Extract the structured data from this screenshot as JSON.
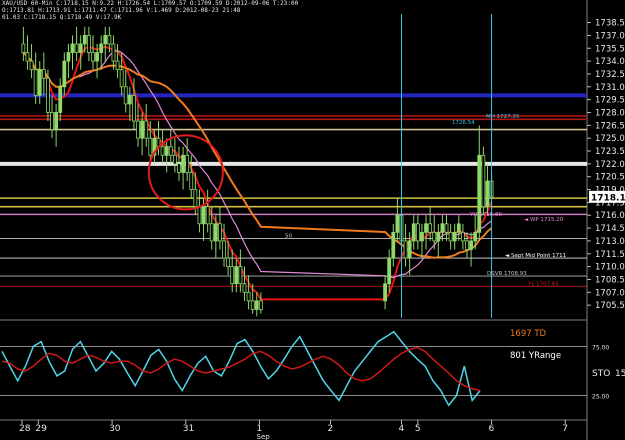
{
  "header": {
    "line1": "XAU/USD 60-Min  C:1718.15  N:9.22  H:1726.54  L:1709.57  O:1709.59  D:2012-09-06  T:23:00",
    "line2": "O:1713.81  H:1713.91  L:1711.47  C:1711.96  V:1.469  D:2012-08-23  21:48",
    "line3": "01.03  C:1718.15  Q:1718.49  V:17.9K"
  },
  "colors": {
    "background": "#000000",
    "candle": "#8fd86a",
    "sma_slow": "#f07a1e",
    "sma_fast": "#e81515",
    "band_upper": "#f0c8f0",
    "band_lower": "#f0e6c8",
    "band_mid": "#e48ad8",
    "yellow_level": "#e8d34a",
    "cyan": "#39c7e8",
    "stoch_fast": "#4fd6e8",
    "stoch_slow": "#d01818",
    "white_level": "#ffffff",
    "blue_level": "#2a2ad8",
    "highlight_circle": "#e01c1c"
  },
  "chart_data": {
    "type": "candlestick",
    "instrument": "XAU/USD",
    "timeframe": "60-Min",
    "price_axis": {
      "ylim": [
        1704.0,
        1739.5
      ],
      "ticks": [
        1738.5,
        1737.0,
        1735.5,
        1734.0,
        1732.5,
        1731.0,
        1729.5,
        1728.0,
        1726.5,
        1725.0,
        1723.5,
        1722.0,
        1720.5,
        1719.0,
        1717.5,
        1716.0,
        1714.5,
        1713.0,
        1711.5,
        1710.0,
        1708.5,
        1707.0,
        1705.5
      ],
      "tick_labels": [
        "1738.50",
        "1737.00",
        "1735.50",
        "1734.00",
        "1732.50",
        "1731.00",
        "1729.50",
        "1728.00",
        "1726.50",
        "1725.00",
        "1723.50",
        "1722.00",
        "1720.50",
        "1719.00",
        "1717.50",
        "1716.00",
        "1714.50",
        "1713.00",
        "1711.50",
        "1710.00",
        "1708.50",
        "1707.00",
        "1705.50"
      ],
      "last_price": 1718.15,
      "last_price_label": "1718.15"
    },
    "x_axis": {
      "labels": [
        {
          "text": "28",
          "day_index": 0
        },
        {
          "text": "29",
          "day_index": 0.6
        },
        {
          "text": "30",
          "day_index": 3.3
        },
        {
          "text": "31",
          "day_index": 6.0
        },
        {
          "text": "1",
          "day_index": 8.7
        },
        {
          "text": "Sep",
          "day_index": 8.7
        },
        {
          "text": "2",
          "day_index": 11.3
        },
        {
          "text": "4",
          "day_index": 13.9
        },
        {
          "text": "5",
          "day_index": 14.5
        },
        {
          "text": "6",
          "day_index": 17.2
        },
        {
          "text": "7",
          "day_index": 19.9
        }
      ]
    },
    "candles": [
      [
        0.05,
        1736,
        1738,
        1734,
        1735
      ],
      [
        0.2,
        1735,
        1737,
        1733,
        1734
      ],
      [
        0.35,
        1734,
        1736,
        1732,
        1733
      ],
      [
        0.5,
        1733,
        1735,
        1729,
        1730
      ],
      [
        0.65,
        1730,
        1734,
        1729,
        1733
      ],
      [
        0.8,
        1733,
        1735,
        1730,
        1732
      ],
      [
        0.95,
        1732,
        1733,
        1727,
        1728
      ],
      [
        1.1,
        1728,
        1730,
        1725,
        1726
      ],
      [
        1.25,
        1726,
        1729,
        1724,
        1728
      ],
      [
        1.4,
        1728,
        1732,
        1727,
        1731
      ],
      [
        1.55,
        1731,
        1735,
        1730,
        1734
      ],
      [
        1.7,
        1734,
        1736,
        1732,
        1735
      ],
      [
        1.85,
        1735,
        1737,
        1733,
        1736
      ],
      [
        2.0,
        1736,
        1738,
        1734,
        1735
      ],
      [
        2.15,
        1735,
        1737,
        1733,
        1736
      ],
      [
        2.3,
        1736,
        1738,
        1735,
        1737
      ],
      [
        2.45,
        1737,
        1738,
        1734,
        1735
      ],
      [
        2.6,
        1735,
        1737,
        1733,
        1734
      ],
      [
        2.75,
        1734,
        1736,
        1732,
        1735
      ],
      [
        2.9,
        1735,
        1737,
        1733,
        1736
      ],
      [
        3.05,
        1736,
        1738,
        1734,
        1737
      ],
      [
        3.2,
        1737,
        1738,
        1735,
        1736
      ],
      [
        3.35,
        1736,
        1737,
        1733,
        1734
      ],
      [
        3.5,
        1734,
        1736,
        1732,
        1733
      ],
      [
        3.65,
        1733,
        1735,
        1730,
        1731
      ],
      [
        3.8,
        1731,
        1733,
        1728,
        1729
      ],
      [
        3.95,
        1729,
        1731,
        1727,
        1730
      ],
      [
        4.1,
        1730,
        1732,
        1726,
        1727
      ],
      [
        4.25,
        1727,
        1729,
        1724,
        1725
      ],
      [
        4.4,
        1725,
        1728,
        1723,
        1727
      ],
      [
        4.55,
        1727,
        1729,
        1724,
        1725
      ],
      [
        4.7,
        1725,
        1727,
        1722,
        1723
      ],
      [
        4.85,
        1723,
        1726,
        1722,
        1725
      ],
      [
        5.0,
        1725,
        1727,
        1723,
        1724
      ],
      [
        5.15,
        1724,
        1726,
        1722,
        1723
      ],
      [
        5.3,
        1723,
        1725,
        1721,
        1724
      ],
      [
        5.45,
        1724,
        1726,
        1722,
        1723
      ],
      [
        5.6,
        1723,
        1725,
        1721,
        1722
      ],
      [
        5.75,
        1722,
        1724,
        1720,
        1721
      ],
      [
        5.9,
        1721,
        1724,
        1719,
        1723
      ],
      [
        6.05,
        1723,
        1725,
        1720,
        1721
      ],
      [
        6.2,
        1721,
        1723,
        1718,
        1719
      ],
      [
        6.35,
        1719,
        1721,
        1716,
        1717
      ],
      [
        6.5,
        1717,
        1719,
        1714,
        1715
      ],
      [
        6.65,
        1715,
        1718,
        1713,
        1717
      ],
      [
        6.8,
        1717,
        1719,
        1714,
        1715
      ],
      [
        6.95,
        1715,
        1717,
        1712,
        1713
      ],
      [
        7.1,
        1713,
        1716,
        1711,
        1715
      ],
      [
        7.25,
        1715,
        1717,
        1712,
        1713
      ],
      [
        7.4,
        1713,
        1715,
        1710,
        1711
      ],
      [
        7.55,
        1711,
        1713,
        1709,
        1710
      ],
      [
        7.7,
        1710,
        1712,
        1707,
        1708
      ],
      [
        7.85,
        1708,
        1711,
        1707,
        1710
      ],
      [
        8.0,
        1710,
        1712,
        1707,
        1708
      ],
      [
        8.15,
        1708,
        1710,
        1706,
        1707
      ],
      [
        8.3,
        1707,
        1709,
        1705,
        1706
      ],
      [
        8.45,
        1706,
        1708,
        1704.5,
        1705
      ],
      [
        8.6,
        1705,
        1707,
        1704.2,
        1706
      ],
      [
        8.75,
        1706,
        1707,
        1704.5,
        1705
      ],
      [
        13.3,
        1706,
        1709,
        1705,
        1708
      ],
      [
        13.45,
        1708,
        1712,
        1707,
        1711
      ],
      [
        13.6,
        1711,
        1715,
        1710,
        1714
      ],
      [
        13.75,
        1714,
        1718,
        1713,
        1716
      ],
      [
        13.9,
        1716,
        1717,
        1712,
        1713
      ],
      [
        14.05,
        1713,
        1715,
        1710,
        1711
      ],
      [
        14.2,
        1711,
        1714,
        1709,
        1713
      ],
      [
        14.35,
        1713,
        1716,
        1712,
        1715
      ],
      [
        14.5,
        1715,
        1716,
        1712,
        1713
      ],
      [
        14.65,
        1713,
        1715,
        1711,
        1714
      ],
      [
        14.8,
        1714,
        1716,
        1712,
        1715
      ],
      [
        14.95,
        1715,
        1717,
        1713,
        1714
      ],
      [
        15.1,
        1714,
        1716,
        1712,
        1713
      ],
      [
        15.25,
        1713,
        1715,
        1711,
        1714
      ],
      [
        15.4,
        1714,
        1716,
        1713,
        1715
      ],
      [
        15.55,
        1715,
        1716,
        1713,
        1714
      ],
      [
        15.7,
        1714,
        1715,
        1712,
        1713
      ],
      [
        15.85,
        1713,
        1715,
        1712,
        1714
      ],
      [
        16.0,
        1714,
        1716,
        1713,
        1715
      ],
      [
        16.15,
        1714,
        1715,
        1712,
        1713
      ],
      [
        16.3,
        1713,
        1714,
        1711,
        1712
      ],
      [
        16.45,
        1712,
        1714,
        1710,
        1713
      ],
      [
        16.6,
        1713,
        1716,
        1712,
        1714
      ],
      [
        16.75,
        1714,
        1726.5,
        1713,
        1723
      ],
      [
        16.9,
        1723,
        1724,
        1716,
        1717
      ],
      [
        17.05,
        1717,
        1722,
        1716,
        1720
      ],
      [
        17.2,
        1720,
        1721,
        1716,
        1718.15
      ]
    ],
    "horizontal_levels": [
      {
        "price": 1722.0,
        "color": "#ffffff",
        "style": "thick"
      },
      {
        "price": 1730.0,
        "color": "#2a2ad8",
        "style": "thick"
      },
      {
        "price": 1727.6,
        "color": "#c51a1a",
        "style": "solid"
      },
      {
        "price": 1727.2,
        "color": "#c51a1a",
        "style": "solid"
      },
      {
        "price": 1726.0,
        "color": "#e8d6a0",
        "style": "solid"
      },
      {
        "price": 1718.0,
        "color": "#e8d34a",
        "style": "solid"
      },
      {
        "price": 1717.0,
        "color": "#e8d34a",
        "style": "solid"
      },
      {
        "price": 1716.1,
        "color": "#e48ad8",
        "style": "solid"
      },
      {
        "price": 1713.3,
        "color": "#ffffff",
        "style": "thin"
      },
      {
        "price": 1711.0,
        "color": "#ffffff",
        "style": "thin"
      },
      {
        "price": 1708.9,
        "color": "#c8c8c8",
        "style": "thin"
      },
      {
        "price": 1707.7,
        "color": "#d02020",
        "style": "thin"
      }
    ],
    "level_labels": [
      {
        "text": "MH 1727.25",
        "price": 1727.25,
        "color": "#39c7e8"
      },
      {
        "text": "1726.54",
        "price": 1726.54,
        "color": "#39c7e8"
      },
      {
        "text": "YH 1715.80",
        "price": 1715.8,
        "color": "#e48ad8"
      },
      {
        "text": "◄ WP 1715.20",
        "price": 1715.2,
        "color": "#e48ad8"
      },
      {
        "text": "50",
        "price": 1713.3,
        "color": "#c8c8c8"
      },
      {
        "text": "◄ Sept Mid Point 1711",
        "price": 1711.0,
        "color": "#ffffff"
      },
      {
        "text": "DSVR 1708.93",
        "price": 1708.93,
        "color": "#c8c8c8"
      },
      {
        "text": "YL 1707.65",
        "price": 1707.65,
        "color": "#d02020"
      }
    ],
    "oscillator": {
      "title": "STO",
      "value_label": "15",
      "levels": [
        25.0,
        75.0
      ],
      "level_labels": [
        "25.00",
        "75.00"
      ],
      "annotations": [
        {
          "text": "1697 TD",
          "color": "#f07a1e"
        },
        {
          "text": "801 YRange",
          "color": "#ffffff"
        }
      ],
      "fast": [
        70,
        55,
        40,
        55,
        75,
        80,
        60,
        45,
        50,
        72,
        80,
        65,
        50,
        58,
        70,
        62,
        48,
        35,
        50,
        66,
        72,
        60,
        42,
        30,
        45,
        58,
        65,
        50,
        45,
        60,
        78,
        82,
        70,
        55,
        42,
        50,
        62,
        75,
        85,
        70,
        55,
        40,
        30,
        20,
        35,
        50,
        60,
        70,
        80,
        85,
        90,
        80,
        70,
        62,
        55,
        40,
        30,
        15,
        25,
        55,
        20,
        30
      ],
      "slow": [
        60,
        58,
        52,
        50,
        55,
        62,
        68,
        66,
        60,
        58,
        62,
        66,
        64,
        60,
        58,
        60,
        60,
        56,
        50,
        48,
        52,
        58,
        62,
        60,
        55,
        50,
        48,
        50,
        52,
        54,
        58,
        62,
        68,
        70,
        66,
        60,
        55,
        52,
        54,
        58,
        62,
        65,
        62,
        56,
        48,
        42,
        40,
        42,
        48,
        55,
        62,
        68,
        72,
        74,
        70,
        62,
        55,
        48,
        40,
        35,
        32,
        30
      ]
    }
  }
}
